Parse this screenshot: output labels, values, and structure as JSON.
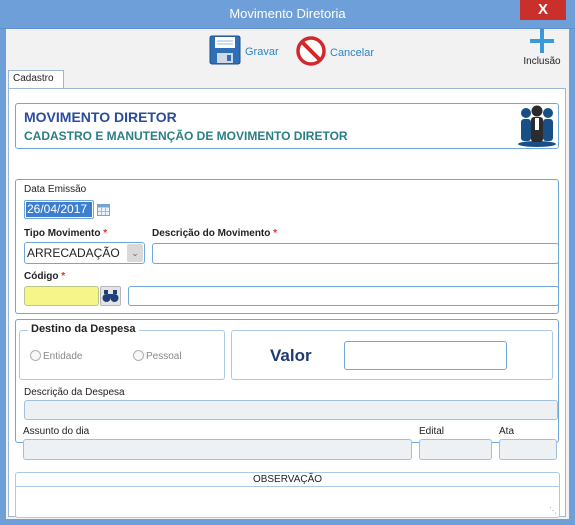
{
  "window": {
    "title": "Movimento Diretoria",
    "close_label": "X"
  },
  "toolbar": {
    "save_label": "Gravar",
    "cancel_label": "Cancelar",
    "add_label": "Inclusão"
  },
  "tabs": [
    {
      "label": "Cadastro"
    }
  ],
  "header": {
    "title": "MOVIMENTO DIRETOR",
    "subtitle": "CADASTRO E MANUTENÇÃO DE MOVIMENTO DIRETOR"
  },
  "form": {
    "data_emissao": {
      "label": "Data Emissão",
      "value": "26/04/2017"
    },
    "tipo_movimento": {
      "label": "Tipo Movimento",
      "value": "ARRECADAÇÃO"
    },
    "descricao_movimento": {
      "label": "Descrição do Movimento",
      "value": ""
    },
    "codigo": {
      "label": "Código",
      "value": ""
    },
    "codigo_descricao": {
      "value": ""
    },
    "destino": {
      "legend": "Destino da Despesa",
      "option1": "Entidade",
      "option2": "Pessoal"
    },
    "valor": {
      "label": "Valor",
      "value": ""
    },
    "descricao_despesa": {
      "label": "Descrição da Despesa",
      "value": ""
    },
    "assunto": {
      "label": "Assunto do dia",
      "value": ""
    },
    "edital": {
      "label": "Edital",
      "value": ""
    },
    "ata": {
      "label": "Ata",
      "value": ""
    },
    "observacao": {
      "label": "OBSERVAÇÃO",
      "value": ""
    },
    "required_mark": "*"
  },
  "colors": {
    "accent": "#6f9fd8",
    "field_border": "#6fa8d8",
    "title_blue": "#2a4c9e",
    "subtitle_teal": "#2a7f86",
    "required": "#d9342b",
    "highlight": "#f5f58a"
  }
}
